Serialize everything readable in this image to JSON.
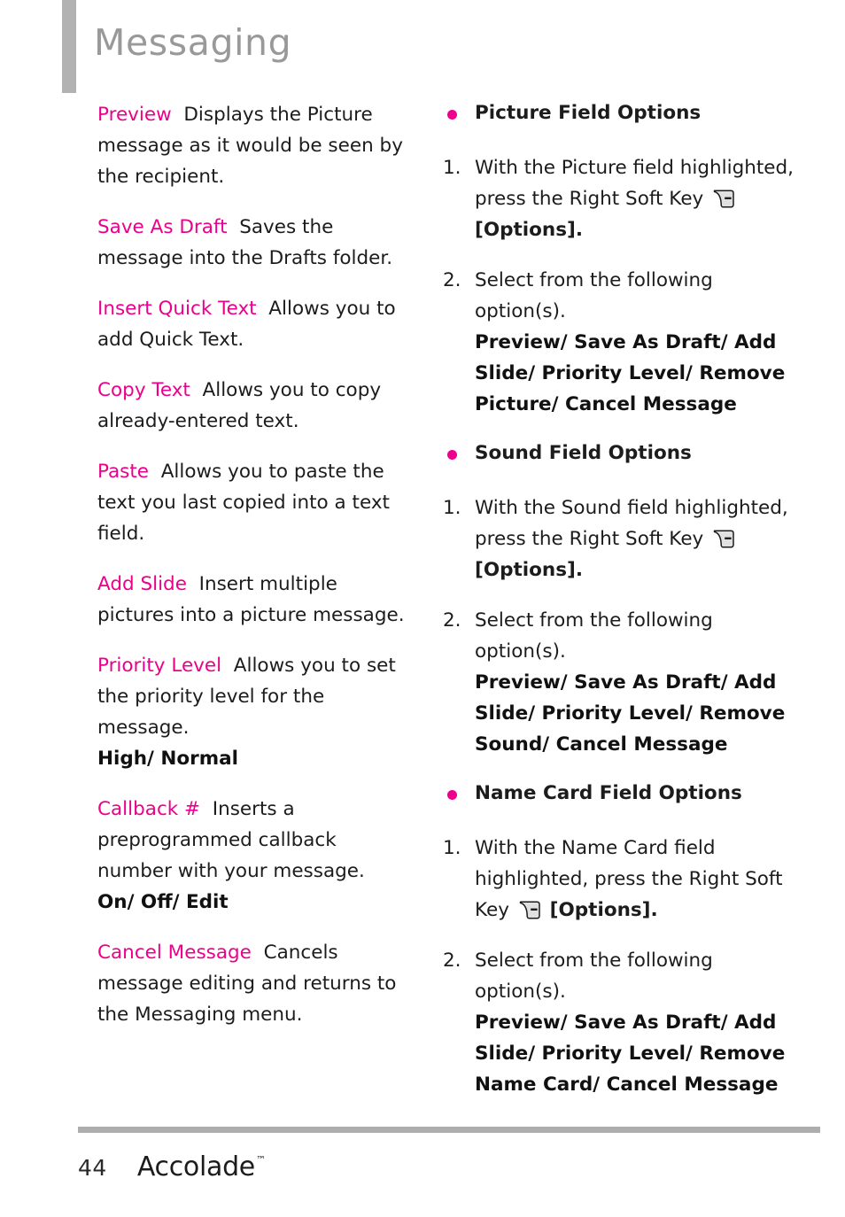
{
  "header": {
    "title": "Messaging",
    "accent_bar_color": "#b2b2b2",
    "title_color": "#999999"
  },
  "theme": {
    "accent_magenta": "#ec008c",
    "body_text": "#1c1c1c",
    "rule_gray": "#adadad"
  },
  "left_column": {
    "definitions": [
      {
        "term": "Preview",
        "description": "Displays the Picture message as it would be seen by the recipient.",
        "sub": ""
      },
      {
        "term": "Save As Draft",
        "description": "Saves the message into the Drafts folder.",
        "sub": ""
      },
      {
        "term": "Insert Quick Text",
        "description": "Allows you to add Quick Text.",
        "sub": ""
      },
      {
        "term": "Copy Text",
        "description": "Allows you to copy already-entered text.",
        "sub": ""
      },
      {
        "term": "Paste",
        "description": "Allows you to paste the text you last copied into a text field.",
        "sub": ""
      },
      {
        "term": "Add Slide",
        "description": "Insert multiple pictures into a picture message.",
        "sub": ""
      },
      {
        "term": "Priority Level",
        "description": "Allows you to set the priority level for the message.",
        "sub": "High/ Normal"
      },
      {
        "term": "Callback #",
        "description": "Inserts a preprogrammed callback number with your message.",
        "sub": "On/ Off/ Edit"
      },
      {
        "term": "Cancel Message",
        "description": "Cancels message editing and returns to the Messaging menu.",
        "sub": ""
      }
    ]
  },
  "right_column": {
    "sections": [
      {
        "heading": "Picture Field Options",
        "step1_num": "1.",
        "step1_text_before": "With the Picture field highlighted, press the Right Soft Key",
        "step1_icon": "soft-key-icon",
        "step1_text_after": "[Options].",
        "step2_num": "2.",
        "step2_text": "Select from the following option(s).",
        "step2_options": "Preview/ Save As Draft/ Add Slide/ Priority Level/ Remove Picture/ Cancel Message"
      },
      {
        "heading": "Sound Field Options",
        "step1_num": "1.",
        "step1_text_before": "With the Sound field highlighted, press the Right Soft Key",
        "step1_icon": "soft-key-icon",
        "step1_text_after": "[Options].",
        "step2_num": "2.",
        "step2_text": "Select from the following option(s).",
        "step2_options": "Preview/ Save As Draft/ Add Slide/ Priority Level/ Remove Sound/ Cancel Message"
      },
      {
        "heading": "Name Card Field Options",
        "step1_num": "1.",
        "step1_text_before": "With the Name Card field highlighted, press the Right Soft Key",
        "step1_icon": "soft-key-icon",
        "step1_text_after": "[Options].",
        "step2_num": "2.",
        "step2_text": "Select from the following option(s).",
        "step2_options": "Preview/ Save As Draft/ Add Slide/ Priority Level/ Remove Name Card/ Cancel Message"
      }
    ]
  },
  "footer": {
    "page_number": "44",
    "brand": "Accolade",
    "trademark": "™"
  }
}
